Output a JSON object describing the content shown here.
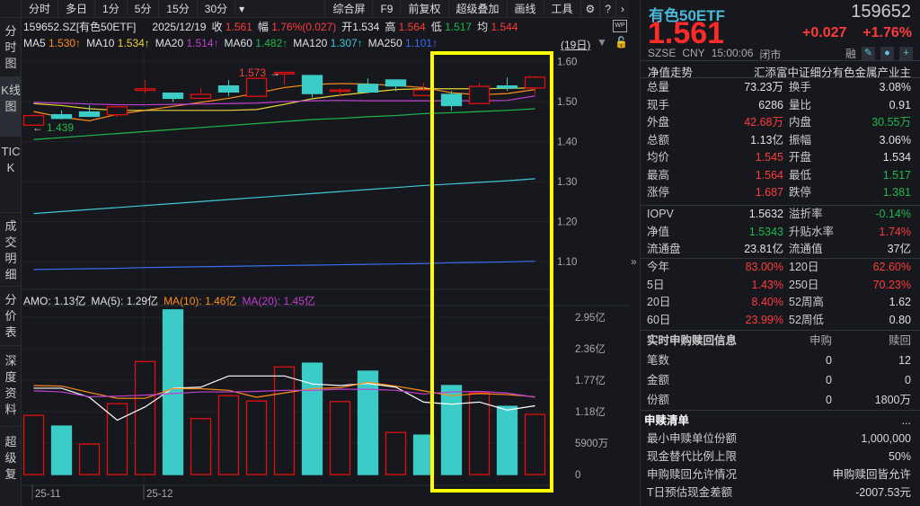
{
  "toolbar": {
    "left": [
      "分时",
      "多日",
      "1分",
      "5分",
      "15分",
      "30分"
    ],
    "dropdown": "▾",
    "right": [
      "综合屏",
      "F9",
      "前复权",
      "超级叠加",
      "画线",
      "工具"
    ]
  },
  "sidebar": [
    "分时图",
    "K线图",
    "TICK",
    "成交明细",
    "分价表",
    "深度资料",
    "超级复"
  ],
  "info": {
    "code": "159652.SZ[有色50ETF]",
    "date": "2025/12/19",
    "close_label": "收",
    "close": "1.561",
    "chg_label": "幅",
    "chg": "1.76%(0.027)",
    "open_label": "开",
    "open": "1.534",
    "high_label": "高",
    "high": "1.564",
    "low_label": "低",
    "low": "1.517",
    "avg_label": "均",
    "avg": "1.544"
  },
  "ma": [
    {
      "label": "MA5",
      "value": "1.530↑",
      "color": "#ff8c1a"
    },
    {
      "label": "MA10",
      "value": "1.534↑",
      "color": "#e8d23a"
    },
    {
      "label": "MA20",
      "value": "1.514↑",
      "color": "#c040d0"
    },
    {
      "label": "MA60",
      "value": "1.482↑",
      "color": "#1fb84a"
    },
    {
      "label": "MA120",
      "value": "1.307↑",
      "color": "#3fc8d8"
    },
    {
      "label": "MA250",
      "value": "1.101↑",
      "color": "#3a6cf0"
    }
  ],
  "period": "(19日)",
  "annotations": {
    "max": "1.573",
    "min": "1.439"
  },
  "amo": {
    "amo": "AMO: 1.13亿",
    "ma5": "MA(5): 1.29亿",
    "ma10": "MA(10): 1.46亿",
    "ma20": "MA(20): 1.45亿"
  },
  "colors": {
    "up": "#e01010",
    "down": "#3cccc8",
    "highlight": "#ffff00"
  },
  "chart_data": [
    {
      "type": "candlestick",
      "title": "K线",
      "ylim": [
        1.05,
        1.62
      ],
      "yticks": [
        "1.60",
        "1.50",
        "1.40",
        "1.30",
        "1.20",
        "1.10"
      ],
      "ytick_values": [
        1.6,
        1.5,
        1.4,
        1.3,
        1.2,
        1.1
      ],
      "ohlc": [
        [
          1.441,
          1.465,
          1.468,
          1.439
        ],
        [
          1.467,
          1.458,
          1.478,
          1.455
        ],
        [
          1.474,
          1.463,
          1.491,
          1.461
        ],
        [
          1.467,
          1.487,
          1.488,
          1.461
        ],
        [
          1.528,
          1.532,
          1.554,
          1.521
        ],
        [
          1.521,
          1.508,
          1.521,
          1.499
        ],
        [
          1.508,
          1.518,
          1.534,
          1.507
        ],
        [
          1.539,
          1.524,
          1.554,
          1.514
        ],
        [
          1.513,
          1.558,
          1.558,
          1.512
        ],
        [
          1.569,
          1.573,
          1.573,
          1.542
        ],
        [
          1.565,
          1.52,
          1.565,
          1.51
        ],
        [
          1.527,
          1.529,
          1.533,
          1.513
        ],
        [
          1.543,
          1.524,
          1.558,
          1.521
        ],
        [
          1.554,
          1.539,
          1.554,
          1.526
        ],
        [
          1.515,
          1.529,
          1.547,
          1.514
        ],
        [
          1.518,
          1.49,
          1.527,
          1.477
        ],
        [
          1.495,
          1.538,
          1.547,
          1.494
        ],
        [
          1.539,
          1.534,
          1.56,
          1.527
        ],
        [
          1.534,
          1.561,
          1.564,
          1.517
        ]
      ],
      "series": [
        {
          "name": "MA5",
          "color": "#ff8c1a",
          "values": [
            1.475,
            1.461,
            1.452,
            1.468,
            1.478,
            1.488,
            1.498,
            1.508,
            1.521,
            1.535,
            1.543,
            1.545,
            1.544,
            1.54,
            1.535,
            1.522,
            1.517,
            1.52,
            1.53
          ]
        },
        {
          "name": "MA10",
          "color": "#e8d23a",
          "values": [
            1.495,
            1.49,
            1.482,
            1.478,
            1.478,
            1.478,
            1.478,
            1.478,
            1.48,
            1.493,
            1.507,
            1.516,
            1.523,
            1.53,
            1.532,
            1.532,
            1.532,
            1.533,
            1.534
          ]
        },
        {
          "name": "MA20",
          "color": "#c040d0",
          "values": [
            1.498,
            1.496,
            1.494,
            1.492,
            1.492,
            1.493,
            1.494,
            1.495,
            1.496,
            1.5,
            1.502,
            1.503,
            1.502,
            1.502,
            1.502,
            1.502,
            1.502,
            1.503,
            1.514
          ]
        },
        {
          "name": "MA60",
          "color": "#1fb84a",
          "values": [
            1.405,
            1.41,
            1.415,
            1.42,
            1.425,
            1.43,
            1.435,
            1.44,
            1.445,
            1.45,
            1.455,
            1.458,
            1.462,
            1.465,
            1.47,
            1.472,
            1.475,
            1.478,
            1.482
          ]
        },
        {
          "name": "MA120",
          "color": "#3fc8d8",
          "values": [
            1.22,
            1.225,
            1.23,
            1.235,
            1.24,
            1.245,
            1.25,
            1.255,
            1.26,
            1.265,
            1.27,
            1.275,
            1.28,
            1.285,
            1.29,
            1.294,
            1.298,
            1.302,
            1.307
          ]
        },
        {
          "name": "MA250",
          "color": "#3a6cf0",
          "values": [
            1.08,
            1.081,
            1.082,
            1.083,
            1.085,
            1.086,
            1.087,
            1.088,
            1.089,
            1.09,
            1.091,
            1.092,
            1.093,
            1.094,
            1.095,
            1.097,
            1.098,
            1.099,
            1.101
          ]
        }
      ]
    },
    {
      "type": "bar",
      "title": "AMO",
      "unit": "亿",
      "ylim": [
        0,
        3.1
      ],
      "yticks": [
        "2.95亿",
        "2.36亿",
        "1.77亿",
        "1.18亿",
        "5900万",
        "0"
      ],
      "ytick_values": [
        2.95,
        2.36,
        1.77,
        1.18,
        0.59,
        0
      ],
      "xticks": [
        "25-11",
        "25-12"
      ],
      "xtick_index": [
        0,
        5
      ],
      "values": [
        1.11,
        0.91,
        0.57,
        1.33,
        2.12,
        3.09,
        1.05,
        1.48,
        1.38,
        2.02,
        2.09,
        1.37,
        1.94,
        0.79,
        0.74,
        1.67,
        1.53,
        1.28,
        1.13
      ],
      "up": [
        true,
        false,
        true,
        true,
        true,
        false,
        true,
        true,
        true,
        true,
        false,
        true,
        false,
        true,
        false,
        false,
        true,
        false,
        true
      ],
      "series": [
        {
          "name": "MA5",
          "color": "#ffffff",
          "values": [
            1.62,
            1.62,
            1.45,
            1.02,
            1.27,
            1.62,
            1.64,
            1.85,
            1.85,
            1.85,
            1.7,
            1.67,
            1.71,
            1.64,
            1.36,
            1.32,
            1.36,
            1.21,
            1.29
          ]
        },
        {
          "name": "MA10",
          "color": "#ff8c1a",
          "values": [
            1.67,
            1.66,
            1.54,
            1.43,
            1.43,
            1.61,
            1.61,
            1.58,
            1.45,
            1.53,
            1.61,
            1.63,
            1.73,
            1.66,
            1.57,
            1.48,
            1.52,
            1.5,
            1.46
          ]
        },
        {
          "name": "MA20",
          "color": "#c040d0",
          "values": [
            1.57,
            1.55,
            1.46,
            1.47,
            1.49,
            1.52,
            1.55,
            1.55,
            1.56,
            1.58,
            1.58,
            1.6,
            1.6,
            1.58,
            1.51,
            1.55,
            1.56,
            1.53,
            1.45
          ]
        }
      ]
    }
  ],
  "quote": {
    "name": "有色50ETF",
    "code": "159652",
    "price": "1.561",
    "change": "+0.027",
    "pct": "+1.76%",
    "exchange": "SZSE",
    "currency": "CNY",
    "time": "15:00:06",
    "status": "闭市",
    "rong": "融",
    "nav_trend": "净值走势",
    "fund_name": "汇添富中证细分有色金属产业主"
  },
  "stats": [
    {
      "l1": "总量",
      "v1": "73.23万",
      "c1": "w",
      "l2": "换手",
      "v2": "3.08%",
      "c2": "w"
    },
    {
      "l1": "现手",
      "v1": "6286",
      "c1": "w",
      "l2": "量比",
      "v2": "0.91",
      "c2": "w"
    },
    {
      "l1": "外盘",
      "v1": "42.68万",
      "c1": "r",
      "l2": "内盘",
      "v2": "30.55万",
      "c2": "g"
    },
    {
      "l1": "总额",
      "v1": "1.13亿",
      "c1": "w",
      "l2": "振幅",
      "v2": "3.06%",
      "c2": "w"
    },
    {
      "l1": "均价",
      "v1": "1.545",
      "c1": "r",
      "l2": "开盘",
      "v2": "1.534",
      "c2": "w"
    },
    {
      "l1": "最高",
      "v1": "1.564",
      "c1": "r",
      "l2": "最低",
      "v2": "1.517",
      "c2": "g"
    },
    {
      "l1": "涨停",
      "v1": "1.687",
      "c1": "r",
      "l2": "跌停",
      "v2": "1.381",
      "c2": "g"
    }
  ],
  "stats2": [
    {
      "l1": "IOPV",
      "v1": "1.5632",
      "c1": "w",
      "l2": "溢折率",
      "v2": "-0.14%",
      "c2": "g"
    },
    {
      "l1": "净值",
      "v1": "1.5343",
      "c1": "g",
      "l2": "升贴水率",
      "v2": "1.74%",
      "c2": "r"
    },
    {
      "l1": "流通盘",
      "v1": "23.81亿",
      "c1": "w",
      "l2": "流通值",
      "v2": "37亿",
      "c2": "w"
    }
  ],
  "stats3": [
    {
      "l1": "今年",
      "v1": "83.00%",
      "c1": "r",
      "l2": "120日",
      "v2": "62.60%",
      "c2": "r"
    },
    {
      "l1": "5日",
      "v1": "1.43%",
      "c1": "r",
      "l2": "250日",
      "v2": "70.23%",
      "c2": "r"
    },
    {
      "l1": "20日",
      "v1": "8.40%",
      "c1": "r",
      "l2": "52周高",
      "v2": "1.62",
      "c2": "w"
    },
    {
      "l1": "60日",
      "v1": "23.99%",
      "c1": "r",
      "l2": "52周低",
      "v2": "0.80",
      "c2": "w"
    }
  ],
  "creation": {
    "title": "实时申购赎回信息",
    "h1": "申购",
    "h2": "赎回",
    "rows": [
      {
        "k": "笔数",
        "a": "0",
        "b": "12"
      },
      {
        "k": "金额",
        "a": "0",
        "b": "0"
      },
      {
        "k": "份额",
        "a": "0",
        "b": "1800万"
      }
    ]
  },
  "list": {
    "title": "申赎清单",
    "more": "...",
    "rows": [
      {
        "k": "最小申赎单位份额",
        "v": "1,000,000"
      },
      {
        "k": "现金替代比例上限",
        "v": "50%"
      },
      {
        "k": "申购赎回允许情况",
        "v": "申购赎回皆允许"
      },
      {
        "k": "T日预估现金差额",
        "v": "-2007.53元"
      }
    ]
  }
}
